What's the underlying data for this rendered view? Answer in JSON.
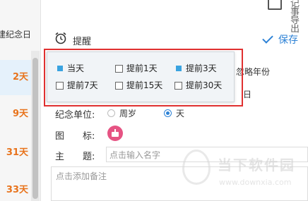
{
  "top_bar": {
    "export_label": "记事导出"
  },
  "left_list": {
    "header": "建纪念日",
    "items": [
      {
        "label": "2天",
        "active": true
      },
      {
        "label": "9天",
        "active": false
      },
      {
        "label": "31天",
        "active": false
      },
      {
        "label": "33天",
        "active": false
      }
    ]
  },
  "reminder": {
    "label": "提醒",
    "save_label": "保存"
  },
  "reminder_popup": {
    "options": [
      {
        "label": "当天",
        "selected": true
      },
      {
        "label": "提前1天",
        "selected": false
      },
      {
        "label": "提前3天",
        "selected": true
      },
      {
        "label": "提前7天",
        "selected": false
      },
      {
        "label": "提前15天",
        "selected": false
      },
      {
        "label": "提前30天",
        "selected": false
      }
    ]
  },
  "hidden_partial": {
    "ignore_year_fragment": "忽略年份",
    "day_fragment": "日"
  },
  "form": {
    "unit_label": "纪念单位:",
    "unit_options": [
      {
        "label": "周岁",
        "checked": false
      },
      {
        "label": "天",
        "checked": true
      }
    ],
    "icon_label": "图　　标:",
    "icon_name": "cake-icon",
    "title_label": "主　　题:",
    "title_placeholder": "点击输入名字",
    "note_placeholder": "点击添加备注"
  },
  "watermark": {
    "text": "当下软件园",
    "url": "www.downxia.com"
  },
  "colors": {
    "accent": "#2d82d6",
    "highlight": "#e03030",
    "days": "#e8731c",
    "checkbox_selected": "#3aa3e0"
  }
}
